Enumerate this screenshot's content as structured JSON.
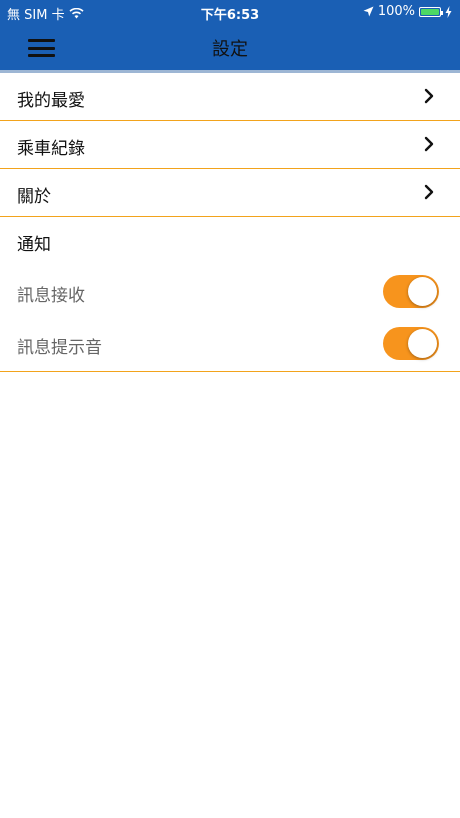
{
  "status_bar": {
    "carrier": "無 SIM 卡",
    "time": "下午6:53",
    "battery": "100%",
    "battery_level": 1.0
  },
  "nav": {
    "title": "設定",
    "menu_icon": "hamburger-menu-icon"
  },
  "rows": [
    {
      "label": "我的最愛",
      "icon": "chevron-right-icon"
    },
    {
      "label": "乘車紀錄",
      "icon": "chevron-right-icon"
    },
    {
      "label": "關於",
      "icon": "chevron-right-icon"
    }
  ],
  "notifications": {
    "title": "通知",
    "items": [
      {
        "label": "訊息接收",
        "on": true
      },
      {
        "label": "訊息提示音",
        "on": true
      }
    ]
  },
  "colors": {
    "header": "#1a5fb4",
    "divider": "#f2a31c",
    "toggle_on": "#f7941d",
    "battery": "#4cd964"
  }
}
